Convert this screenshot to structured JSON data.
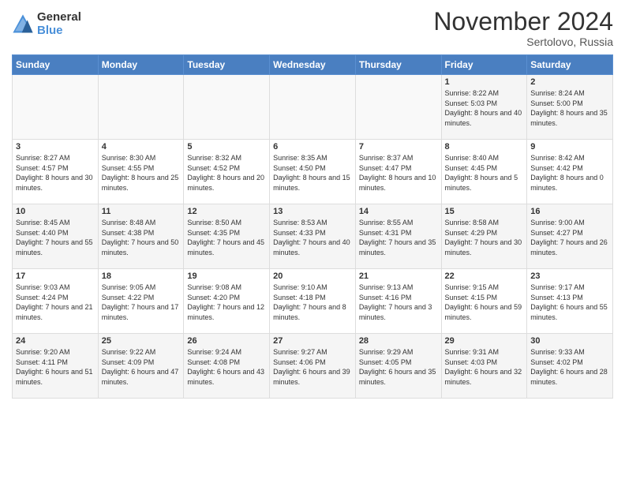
{
  "header": {
    "logo_general": "General",
    "logo_blue": "Blue",
    "month_title": "November 2024",
    "location": "Sertolovo, Russia"
  },
  "weekdays": [
    "Sunday",
    "Monday",
    "Tuesday",
    "Wednesday",
    "Thursday",
    "Friday",
    "Saturday"
  ],
  "weeks": [
    [
      {
        "day": "",
        "info": ""
      },
      {
        "day": "",
        "info": ""
      },
      {
        "day": "",
        "info": ""
      },
      {
        "day": "",
        "info": ""
      },
      {
        "day": "",
        "info": ""
      },
      {
        "day": "1",
        "info": "Sunrise: 8:22 AM\nSunset: 5:03 PM\nDaylight: 8 hours and 40 minutes."
      },
      {
        "day": "2",
        "info": "Sunrise: 8:24 AM\nSunset: 5:00 PM\nDaylight: 8 hours and 35 minutes."
      }
    ],
    [
      {
        "day": "3",
        "info": "Sunrise: 8:27 AM\nSunset: 4:57 PM\nDaylight: 8 hours and 30 minutes."
      },
      {
        "day": "4",
        "info": "Sunrise: 8:30 AM\nSunset: 4:55 PM\nDaylight: 8 hours and 25 minutes."
      },
      {
        "day": "5",
        "info": "Sunrise: 8:32 AM\nSunset: 4:52 PM\nDaylight: 8 hours and 20 minutes."
      },
      {
        "day": "6",
        "info": "Sunrise: 8:35 AM\nSunset: 4:50 PM\nDaylight: 8 hours and 15 minutes."
      },
      {
        "day": "7",
        "info": "Sunrise: 8:37 AM\nSunset: 4:47 PM\nDaylight: 8 hours and 10 minutes."
      },
      {
        "day": "8",
        "info": "Sunrise: 8:40 AM\nSunset: 4:45 PM\nDaylight: 8 hours and 5 minutes."
      },
      {
        "day": "9",
        "info": "Sunrise: 8:42 AM\nSunset: 4:42 PM\nDaylight: 8 hours and 0 minutes."
      }
    ],
    [
      {
        "day": "10",
        "info": "Sunrise: 8:45 AM\nSunset: 4:40 PM\nDaylight: 7 hours and 55 minutes."
      },
      {
        "day": "11",
        "info": "Sunrise: 8:48 AM\nSunset: 4:38 PM\nDaylight: 7 hours and 50 minutes."
      },
      {
        "day": "12",
        "info": "Sunrise: 8:50 AM\nSunset: 4:35 PM\nDaylight: 7 hours and 45 minutes."
      },
      {
        "day": "13",
        "info": "Sunrise: 8:53 AM\nSunset: 4:33 PM\nDaylight: 7 hours and 40 minutes."
      },
      {
        "day": "14",
        "info": "Sunrise: 8:55 AM\nSunset: 4:31 PM\nDaylight: 7 hours and 35 minutes."
      },
      {
        "day": "15",
        "info": "Sunrise: 8:58 AM\nSunset: 4:29 PM\nDaylight: 7 hours and 30 minutes."
      },
      {
        "day": "16",
        "info": "Sunrise: 9:00 AM\nSunset: 4:27 PM\nDaylight: 7 hours and 26 minutes."
      }
    ],
    [
      {
        "day": "17",
        "info": "Sunrise: 9:03 AM\nSunset: 4:24 PM\nDaylight: 7 hours and 21 minutes."
      },
      {
        "day": "18",
        "info": "Sunrise: 9:05 AM\nSunset: 4:22 PM\nDaylight: 7 hours and 17 minutes."
      },
      {
        "day": "19",
        "info": "Sunrise: 9:08 AM\nSunset: 4:20 PM\nDaylight: 7 hours and 12 minutes."
      },
      {
        "day": "20",
        "info": "Sunrise: 9:10 AM\nSunset: 4:18 PM\nDaylight: 7 hours and 8 minutes."
      },
      {
        "day": "21",
        "info": "Sunrise: 9:13 AM\nSunset: 4:16 PM\nDaylight: 7 hours and 3 minutes."
      },
      {
        "day": "22",
        "info": "Sunrise: 9:15 AM\nSunset: 4:15 PM\nDaylight: 6 hours and 59 minutes."
      },
      {
        "day": "23",
        "info": "Sunrise: 9:17 AM\nSunset: 4:13 PM\nDaylight: 6 hours and 55 minutes."
      }
    ],
    [
      {
        "day": "24",
        "info": "Sunrise: 9:20 AM\nSunset: 4:11 PM\nDaylight: 6 hours and 51 minutes."
      },
      {
        "day": "25",
        "info": "Sunrise: 9:22 AM\nSunset: 4:09 PM\nDaylight: 6 hours and 47 minutes."
      },
      {
        "day": "26",
        "info": "Sunrise: 9:24 AM\nSunset: 4:08 PM\nDaylight: 6 hours and 43 minutes."
      },
      {
        "day": "27",
        "info": "Sunrise: 9:27 AM\nSunset: 4:06 PM\nDaylight: 6 hours and 39 minutes."
      },
      {
        "day": "28",
        "info": "Sunrise: 9:29 AM\nSunset: 4:05 PM\nDaylight: 6 hours and 35 minutes."
      },
      {
        "day": "29",
        "info": "Sunrise: 9:31 AM\nSunset: 4:03 PM\nDaylight: 6 hours and 32 minutes."
      },
      {
        "day": "30",
        "info": "Sunrise: 9:33 AM\nSunset: 4:02 PM\nDaylight: 6 hours and 28 minutes."
      }
    ]
  ]
}
